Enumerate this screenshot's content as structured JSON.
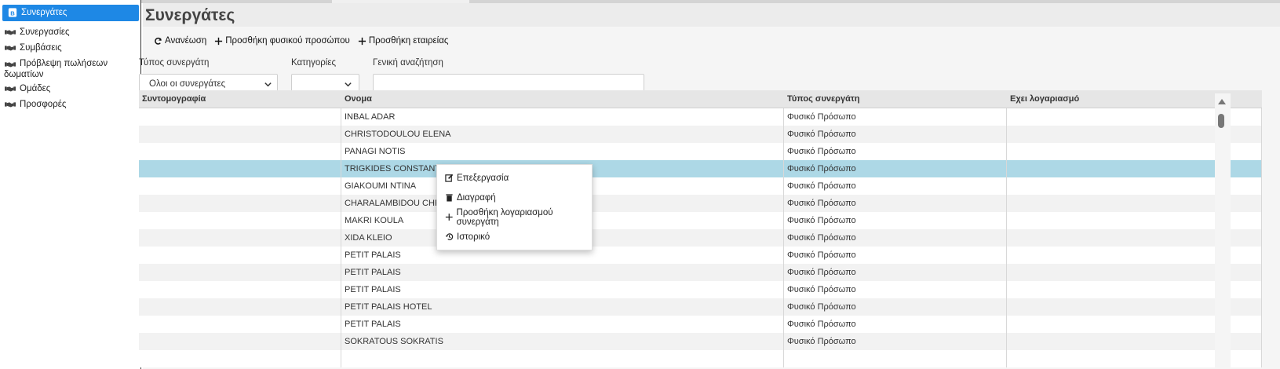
{
  "sidebar": {
    "items": [
      {
        "label": "Συνεργάτες",
        "active": true,
        "icon": "contact-card-icon"
      },
      {
        "label": "Συνεργασίες",
        "icon": "handshake-icon"
      },
      {
        "label": "Συμβάσεις",
        "icon": "handshake-icon"
      },
      {
        "label": "Πρόβλεψη πωλήσεων",
        "label2": "δωματίων",
        "icon": "handshake-icon"
      },
      {
        "label": "Ομάδες",
        "icon": "handshake-icon"
      },
      {
        "label": "Προσφορές",
        "icon": "handshake-icon"
      }
    ]
  },
  "page": {
    "title": "Συνεργάτες"
  },
  "toolbar": {
    "refresh": "Ανανέωση",
    "add_person": "Προσθήκη φυσικού προσώπου",
    "add_company": "Προσθήκη εταιρείας"
  },
  "filters": {
    "type_label": "Τύπος συνεργάτη",
    "type_value": "Ολοι οι συνεργάτες",
    "categories_label": "Κατηγορίες",
    "categories_value": "",
    "search_label": "Γενική αναζήτηση",
    "search_value": ""
  },
  "grid": {
    "columns": [
      "Συντομογραφία",
      "Ονομα",
      "Τύπος συνεργάτη",
      "Εχει λογαριασμό"
    ],
    "rows": [
      {
        "abbr": "",
        "name": "INBAL ADAR",
        "type": "Φυσικό Πρόσωπο",
        "account": ""
      },
      {
        "abbr": "",
        "name": "CHRISTODOULOU ELENA",
        "type": "Φυσικό Πρόσωπο",
        "account": ""
      },
      {
        "abbr": "",
        "name": "PANAGI NOTIS",
        "type": "Φυσικό Πρόσωπο",
        "account": ""
      },
      {
        "abbr": "",
        "name": "TRIGKIDES CONSTANTINOS",
        "type": "Φυσικό Πρόσωπο",
        "account": "",
        "selected": true
      },
      {
        "abbr": "",
        "name": "GIAKOUMI NTINA",
        "type": "Φυσικό Πρόσωπο",
        "account": ""
      },
      {
        "abbr": "",
        "name": "CHARALAMBIDOU CHRISTINA",
        "type": "Φυσικό Πρόσωπο",
        "account": ""
      },
      {
        "abbr": "",
        "name": "MAKRI KOULA",
        "type": "Φυσικό Πρόσωπο",
        "account": ""
      },
      {
        "abbr": "",
        "name": "XIDA KLEIO",
        "type": "Φυσικό Πρόσωπο",
        "account": ""
      },
      {
        "abbr": "",
        "name": "PETIT PALAIS",
        "type": "Φυσικό Πρόσωπο",
        "account": ""
      },
      {
        "abbr": "",
        "name": "PETIT PALAIS",
        "type": "Φυσικό Πρόσωπο",
        "account": ""
      },
      {
        "abbr": "",
        "name": "PETIT PALAIS",
        "type": "Φυσικό Πρόσωπο",
        "account": ""
      },
      {
        "abbr": "",
        "name": "PETIT PALAIS HOTEL",
        "type": "Φυσικό Πρόσωπο",
        "account": ""
      },
      {
        "abbr": "",
        "name": "PETIT PALAIS",
        "type": "Φυσικό Πρόσωπο",
        "account": ""
      },
      {
        "abbr": "",
        "name": "SOKRATOUS SOKRATIS",
        "type": "Φυσικό Πρόσωπο",
        "account": ""
      },
      {
        "abbr": "",
        "name": "",
        "type": "",
        "account": ""
      }
    ]
  },
  "context_menu": {
    "items": [
      {
        "label": "Επεξεργασία",
        "icon": "edit-icon"
      },
      {
        "label": "Διαγραφή",
        "icon": "trash-icon"
      },
      {
        "label": "Προσθήκη λογαριασμού συνεργάτη",
        "icon": "plus-icon"
      },
      {
        "label": "Ιστορικό",
        "icon": "history-icon"
      }
    ]
  },
  "colors": {
    "accent": "#1e88e5",
    "selected_row": "#add8e6"
  }
}
